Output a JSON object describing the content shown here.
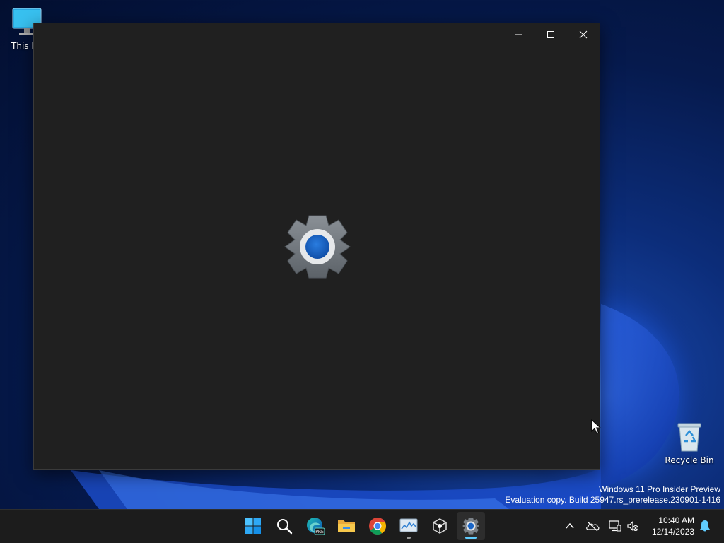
{
  "desktop": {
    "icons": [
      {
        "label": "This PC",
        "icon": "monitor-icon"
      },
      {
        "label": "Recycle Bin",
        "icon": "recycle-bin-icon"
      }
    ],
    "watermark": {
      "line1": "Windows 11 Pro Insider Preview",
      "line2": "Evaluation copy. Build 25947.rs_prerelease.230901-1416"
    }
  },
  "window": {
    "app": "Settings",
    "state": "loading",
    "splash_icon": "gear-icon",
    "controls": [
      "minimize-icon",
      "maximize-icon",
      "close-icon"
    ],
    "background_color": "#202020"
  },
  "taskbar": {
    "apps": [
      {
        "name": "Start",
        "icon": "windows-start-icon"
      },
      {
        "name": "Search",
        "icon": "search-icon"
      },
      {
        "name": "Microsoft Edge Preview",
        "icon": "edge-pre-icon",
        "badge": "PRE"
      },
      {
        "name": "File Explorer",
        "icon": "folder-icon"
      },
      {
        "name": "Google Chrome",
        "icon": "chrome-icon"
      },
      {
        "name": "Task Manager",
        "icon": "task-manager-icon"
      },
      {
        "name": "Package app",
        "icon": "box-icon"
      },
      {
        "name": "Settings",
        "icon": "gear-icon",
        "active": true
      }
    ],
    "tray": {
      "icons": [
        "chevron-up-icon",
        "onedrive-off-icon",
        "network-icon",
        "volume-muted-icon"
      ],
      "time": "10:40 AM",
      "date": "12/14/2023",
      "notification_icon": "bell-icon"
    },
    "accent_color": "#60cdff"
  }
}
